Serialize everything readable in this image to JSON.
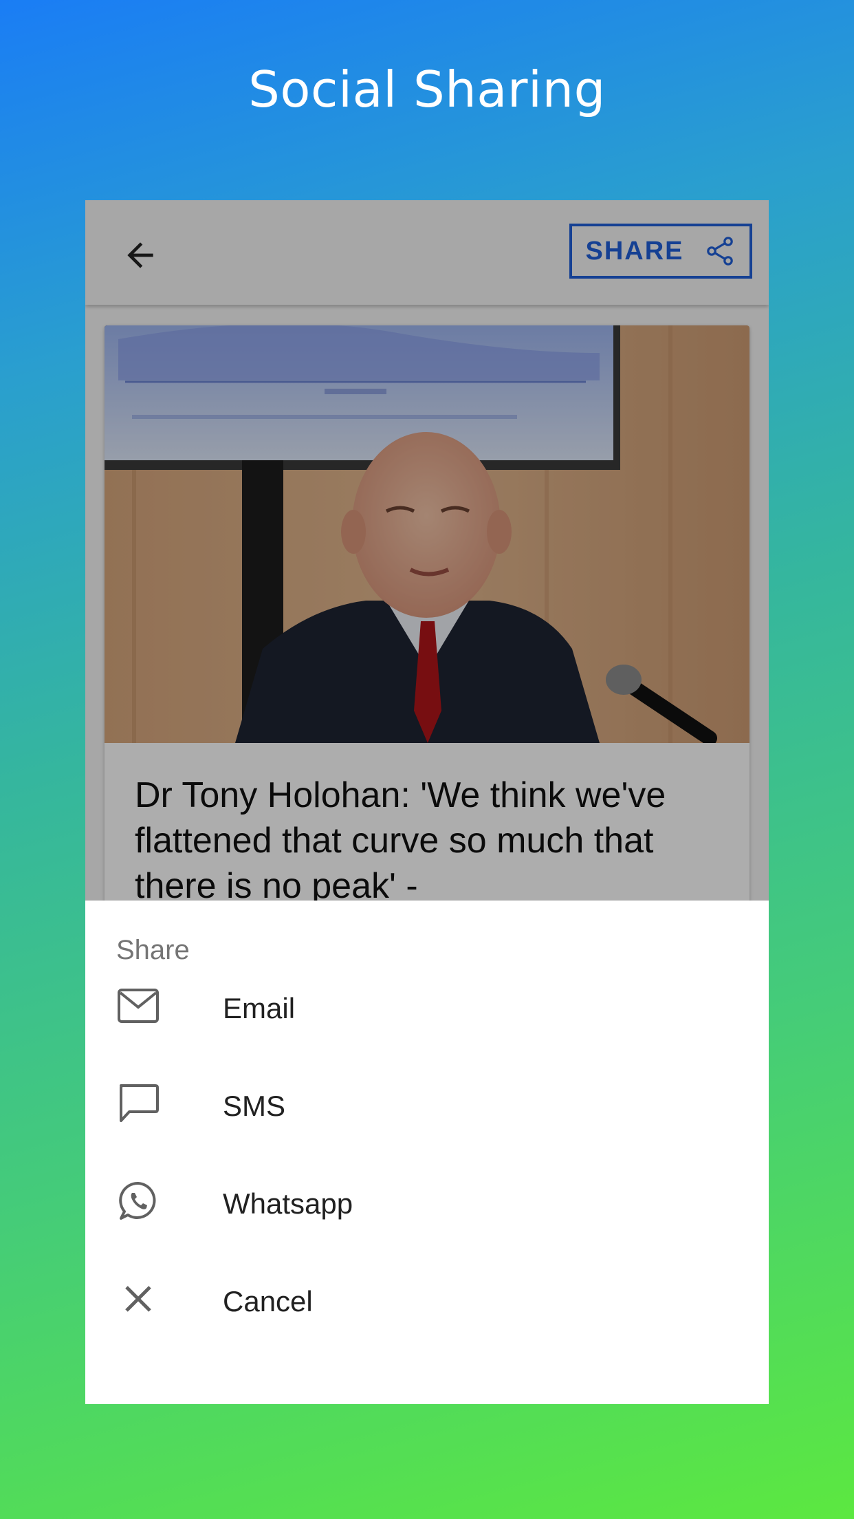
{
  "promo": {
    "title": "Social Sharing"
  },
  "app_bar": {
    "back_icon": "arrow-back-icon",
    "share_label": "SHARE",
    "share_icon": "share-icon"
  },
  "article": {
    "image_icon": "news-photo",
    "headline": "Dr Tony Holohan: 'We think we've flattened that curve so much that there is no peak' -"
  },
  "share_sheet": {
    "title": "Share",
    "items": [
      {
        "label": "Email",
        "icon": "email-icon"
      },
      {
        "label": "SMS",
        "icon": "sms-icon"
      },
      {
        "label": "Whatsapp",
        "icon": "whatsapp-icon"
      },
      {
        "label": "Cancel",
        "icon": "close-icon"
      }
    ]
  },
  "colors": {
    "accent": "#1f5fd9",
    "gradient_start": "#1a7df5",
    "gradient_end": "#5ce840"
  }
}
